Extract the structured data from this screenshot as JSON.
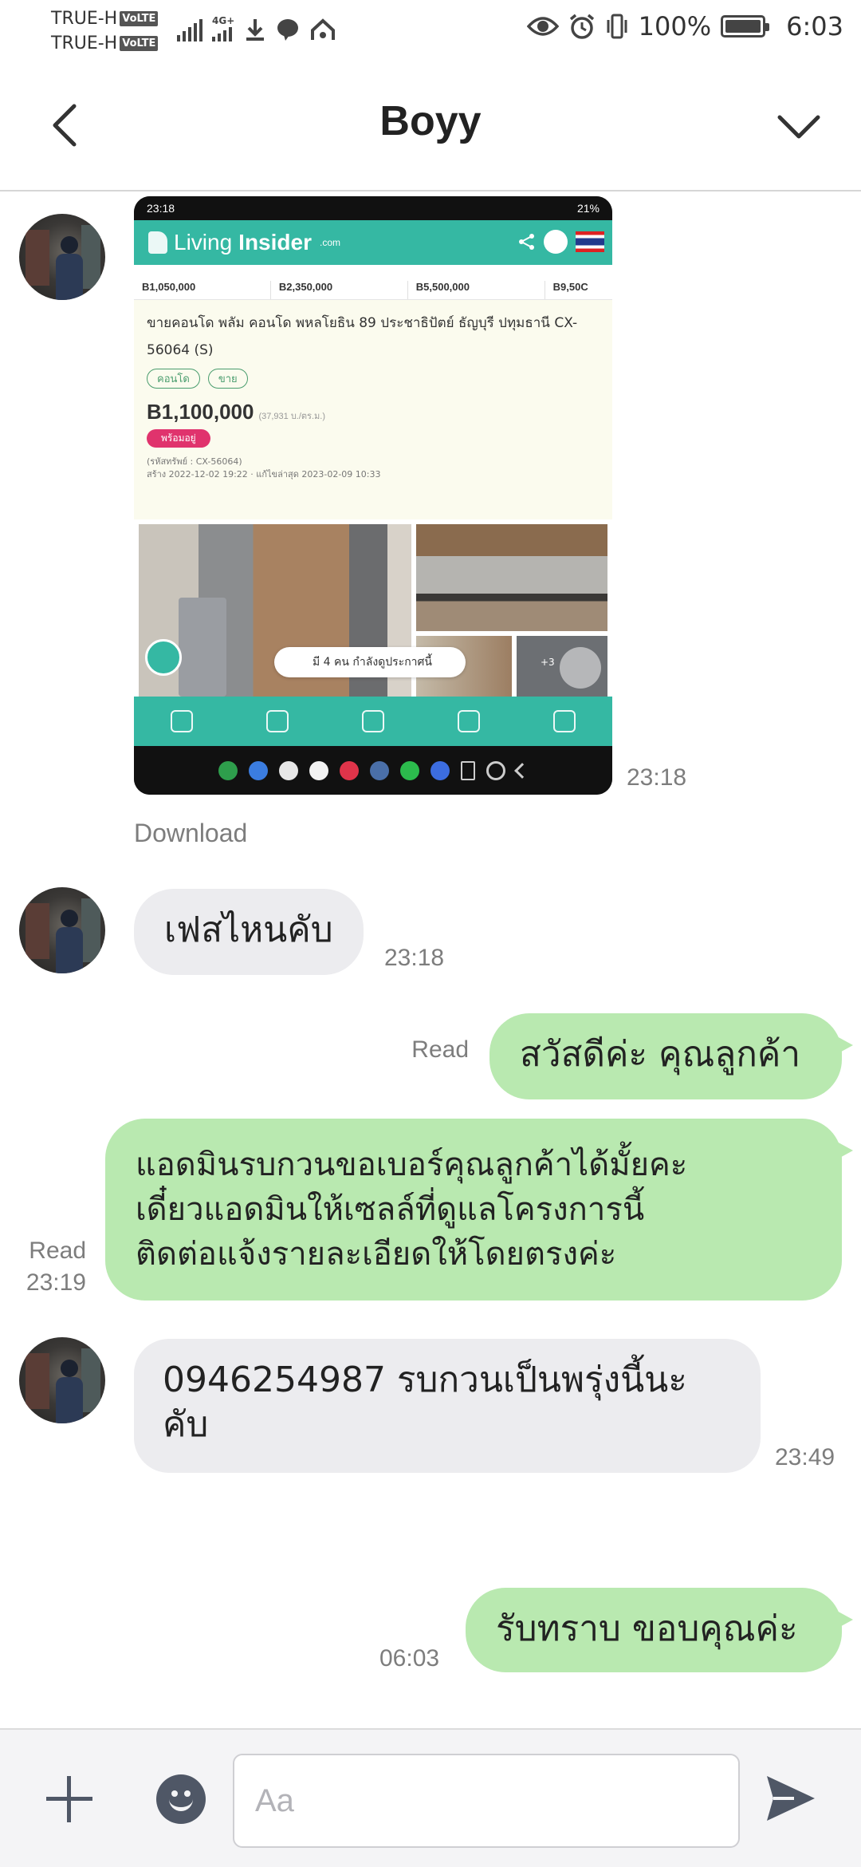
{
  "status_bar": {
    "carrier_1": "TRUE-H",
    "carrier_2": "TRUE-H",
    "volte": "VoLTE",
    "network": "4G+",
    "battery": "100%",
    "clock": "6:03"
  },
  "header": {
    "title": "Boyy"
  },
  "messages": {
    "image_msg": {
      "time": "23:18",
      "download": "Download",
      "screenshot": {
        "status_time": "23:18",
        "status_right": "21%",
        "logo_main": "Living",
        "logo_bold": "Insider",
        "logo_suffix": ".com",
        "prices": [
          "B1,050,000",
          "B2,350,000",
          "B5,500,000",
          "B9,50C"
        ],
        "title": "ขายคอนโด พลัม คอนโด พหลโยธิน 89 ประชาธิปัตย์ ธัญบุรี ปทุมธานี CX-56064 (S)",
        "tags": [
          "คอนโด",
          "ขาย"
        ],
        "price": "B1,100,000",
        "price_sub": "(37,931 บ./ตร.ม.)",
        "ready": "พร้อมอยู่",
        "ref": "(รหัสทรัพย์ : CX-56064)",
        "dates": "สร้าง 2022-12-02 19:22 · แก้ไขล่าสุด 2023-02-09 10:33",
        "viewers": "มี 4 คน กำลังดูประกาศนี้",
        "photo_more": "+3"
      }
    },
    "in_1": {
      "text": "เฟสไหนคับ",
      "time": "23:18"
    },
    "out_1": {
      "text": "สวัสดีค่ะ คุณลูกค้า",
      "read": "Read"
    },
    "out_2": {
      "lines": [
        "แอดมินรบกวนขอเบอร์คุณลูกค้าได้มั้ยคะ",
        "เดี๋ยวแอดมินให้เซลล์ที่ดูแลโครงการนี้",
        "ติดต่อแจ้งรายละเอียดให้โดยตรงค่ะ"
      ],
      "read": "Read",
      "time": "23:19"
    },
    "in_2": {
      "line1": "0946254987 รบกวนเป็นพรุ่งนี้นะ",
      "line2": "คับ",
      "time": "23:49"
    },
    "out_3": {
      "text": "รับทราบ ขอบคุณค่ะ",
      "time": "06:03"
    }
  },
  "input_bar": {
    "placeholder": "Aa",
    "value": ""
  },
  "colors": {
    "outgoing_bubble": "#b9e9b0",
    "incoming_bubble": "#ececef",
    "icon": "#4f5766",
    "app_teal": "#35b8a3"
  }
}
